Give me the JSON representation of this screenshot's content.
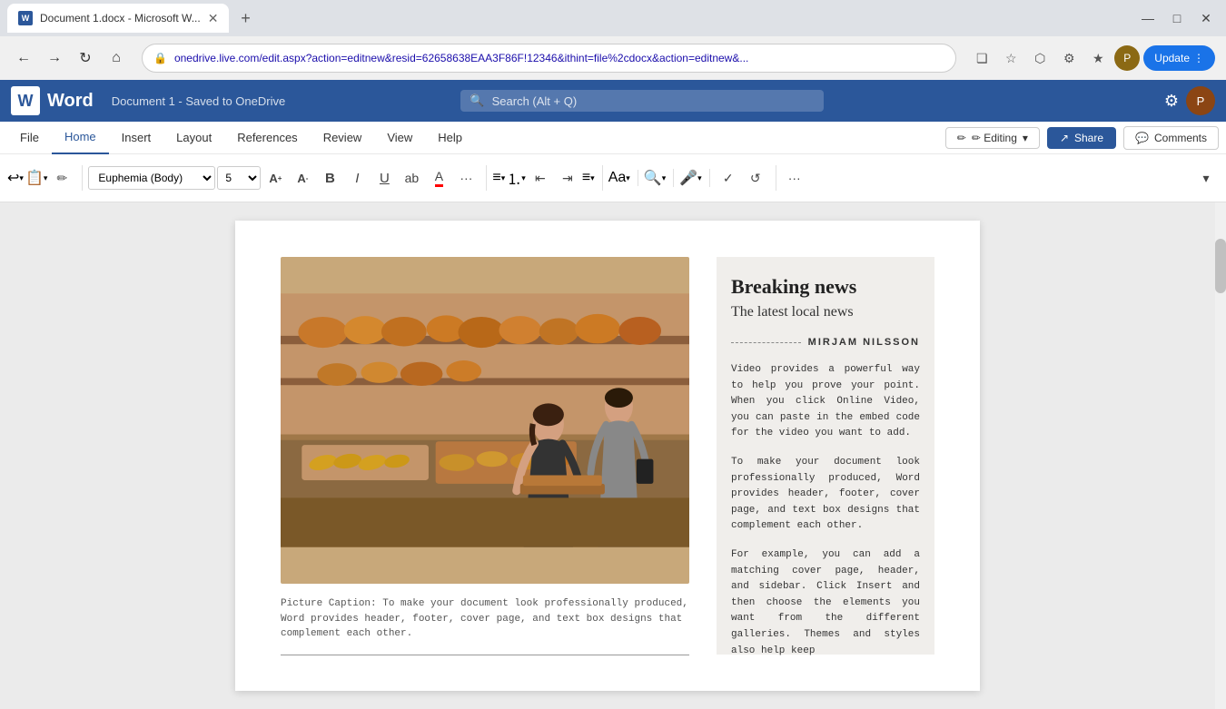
{
  "browser": {
    "tab": {
      "title": "Document 1.docx - Microsoft W...",
      "favicon": "W"
    },
    "new_tab_icon": "+",
    "nav": {
      "back": "←",
      "forward": "→",
      "refresh": "↻",
      "home": "⌂"
    },
    "address": "onedrive.live.com/edit.aspx?action=editnew&resid=62658638EAA3F86F!12346&ithint=file%2cdocx&action=editnew&...",
    "action_icons": [
      "❏",
      "☆",
      "⬡",
      "⚙",
      "★",
      "⬛",
      "☰"
    ],
    "update_label": "Update",
    "win_controls": {
      "minimize": "—",
      "maximize": "□",
      "close": "✕"
    }
  },
  "word": {
    "logo": "W",
    "app_name": "Word",
    "doc_title": "Document 1 - Saved to OneDrive",
    "search_placeholder": "Search (Alt + Q)",
    "settings_icon": "⚙",
    "user_initials": "P"
  },
  "ribbon": {
    "tabs": [
      {
        "id": "file",
        "label": "File"
      },
      {
        "id": "home",
        "label": "Home",
        "active": true
      },
      {
        "id": "insert",
        "label": "Insert"
      },
      {
        "id": "layout",
        "label": "Layout"
      },
      {
        "id": "references",
        "label": "References"
      },
      {
        "id": "review",
        "label": "Review"
      },
      {
        "id": "view",
        "label": "View"
      },
      {
        "id": "help",
        "label": "Help"
      }
    ],
    "editing_label": "✏ Editing",
    "editing_chevron": "▾",
    "share_label": "Share",
    "share_icon": "↗",
    "comments_label": "Comments",
    "comments_icon": "💬",
    "font": {
      "name": "Euphemia (Body)",
      "size": "5"
    },
    "toolbar_buttons": {
      "undo": "↩",
      "undo_arrow": "▾",
      "clipboard": "📋",
      "clipboard_arrow": "▾",
      "format_painter": "✏",
      "increase_font": "A↑",
      "decrease_font": "A↓",
      "bold": "B",
      "italic": "I",
      "underline": "U",
      "highlight": "ab",
      "font_color": "A",
      "more": "···",
      "bullets": "≡",
      "bullets_arrow": "▾",
      "numbering": "⒈",
      "numbering_arrow": "▾",
      "decrease_indent": "←≡",
      "increase_indent": "≡→",
      "align": "≡",
      "align_arrow": "▾",
      "styles": "Aa",
      "styles_arrow": "▾",
      "find": "🔍",
      "find_arrow": "▾",
      "dictate": "🎤",
      "dictate_arrow": "▾",
      "editor": "✓",
      "rewrite": "↺",
      "more_options": "···",
      "expand": "▾"
    }
  },
  "document": {
    "image_alt": "Bakery workers arranging bread and pastries",
    "caption": "Picture Caption: To make your document look professionally produced, Word provides header, footer, cover page, and text box designs that complement each other.",
    "sidebar": {
      "heading1": "Breaking news",
      "heading2": "The latest local news",
      "author_dashes": "—————————",
      "author_name": "MIRJAM NILSSON",
      "paragraphs": [
        "Video provides a powerful way to help you prove your point. When you click Online Video, you can paste in the embed code for the video you want to add.",
        "To make your document look professionally produced, Word provides header, footer, cover page, and text box designs that complement each other.",
        "For example, you can add a matching cover page, header, and sidebar. Click Insert and then choose the elements you want from the different galleries. Themes and styles also help keep"
      ]
    }
  }
}
